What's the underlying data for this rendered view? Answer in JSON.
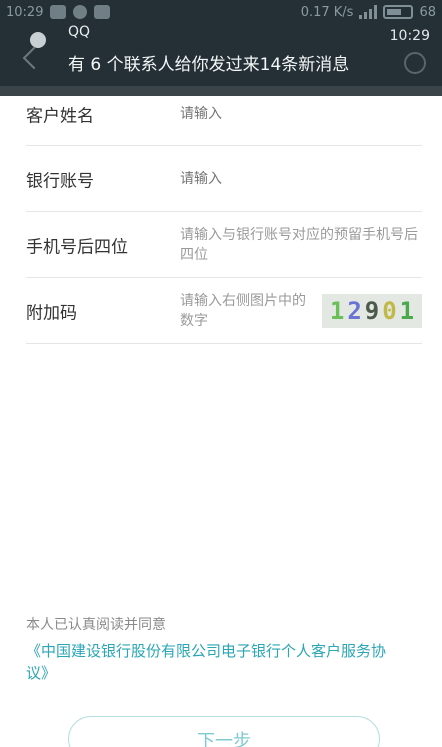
{
  "status_bar": {
    "time": "10:29",
    "speed": "0.17 K/s",
    "battery": "68"
  },
  "notification": {
    "app": "QQ",
    "message": "有 6 个联系人给你发过来14条新消息",
    "time": "10:29"
  },
  "form": {
    "fields": [
      {
        "label": "客户姓名",
        "placeholder": "请输入"
      },
      {
        "label": "银行账号",
        "placeholder": "请输入"
      },
      {
        "label": "手机号后四位",
        "placeholder": "请输入与银行账号对应的预留手机号后四位"
      },
      {
        "label": "附加码",
        "placeholder": "请输入右侧图片中的数字"
      }
    ],
    "captcha_code": "12901"
  },
  "agreement": {
    "label": "本人已认真阅读并同意",
    "link_text": "《中国建设银行股份有限公司电子银行个人客户服务协议》"
  },
  "next_button": "下一步"
}
